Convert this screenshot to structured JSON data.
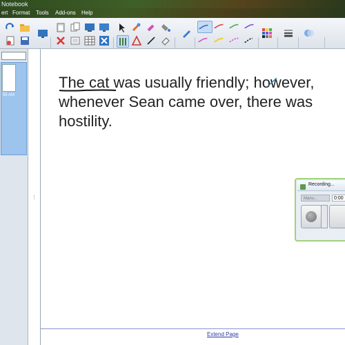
{
  "window": {
    "title": "Notebook"
  },
  "menu": [
    "ert",
    "Format",
    "Tools",
    "Add-ons",
    "Help"
  ],
  "toolbar": {
    "icons": [
      "redo-icon",
      "open-icon",
      "screen-shade-icon",
      "paste-icon",
      "table-icon",
      "capture-icon",
      "select-icon",
      "magic-pen-icon",
      "eraser-icon",
      "pen-icon",
      "line-style-icon",
      "color-palette-icon",
      "properties-icon",
      "shape-icon"
    ]
  },
  "sidebar": {
    "timestamp": "55 AM"
  },
  "page": {
    "text_lines": [
      "The cat was usually friendly; however,",
      "whenever Sean came over, there was",
      "hostility."
    ],
    "extend_label": "Extend Page"
  },
  "recorder": {
    "title": "Recording...",
    "mode": "Manu...",
    "time": "0:00"
  },
  "colors": {
    "accent": "#9fd27a",
    "link": "#2f39a8",
    "pen_blue": "#2b6fc1",
    "pen_red": "#e04545",
    "pen_green": "#4caf50",
    "pen_purple": "#8a4cd8",
    "pen_pink": "#e04dc9",
    "pen_yellow": "#f0d23a"
  }
}
